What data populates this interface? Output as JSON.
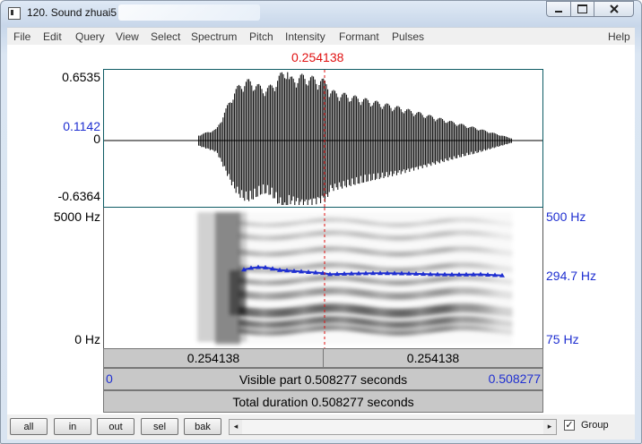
{
  "window": {
    "title": "120. Sound zhuai5",
    "controls": {
      "minimize_icon": "minimize-icon",
      "maximize_icon": "maximize-icon",
      "close_icon": "close-icon"
    }
  },
  "menu": [
    "File",
    "Edit",
    "Query",
    "View",
    "Select",
    "Spectrum",
    "Pitch",
    "Intensity",
    "Formant",
    "Pulses"
  ],
  "help": "Help",
  "cursor": {
    "time": "0.254138",
    "time_seconds": 0.254138
  },
  "waveform": {
    "max_label": "0.6535",
    "cursor_amp_label": "0.1142",
    "zero_label": "0",
    "min_label": "-0.6364"
  },
  "spectrogram": {
    "top_label": "5000 Hz",
    "bottom_label": "0 Hz",
    "pitch_top_label": "500 Hz",
    "pitch_value_label": "294.7 Hz",
    "pitch_bottom_label": "75 Hz",
    "pitch_color": "#1f2fd1"
  },
  "time_bar": {
    "left": "0.254138",
    "right": "0.254138"
  },
  "visible_bar": {
    "start": "0",
    "label": "Visible part 0.508277 seconds",
    "end": "0.508277"
  },
  "total_bar": {
    "label": "Total duration 0.508277 seconds"
  },
  "buttons": [
    "all",
    "in",
    "out",
    "sel",
    "bak"
  ],
  "scroll": {
    "left_arrow": "◂",
    "right_arrow": "▸"
  },
  "group": {
    "checked": true,
    "label": "Group",
    "check_mark": "✓"
  }
}
